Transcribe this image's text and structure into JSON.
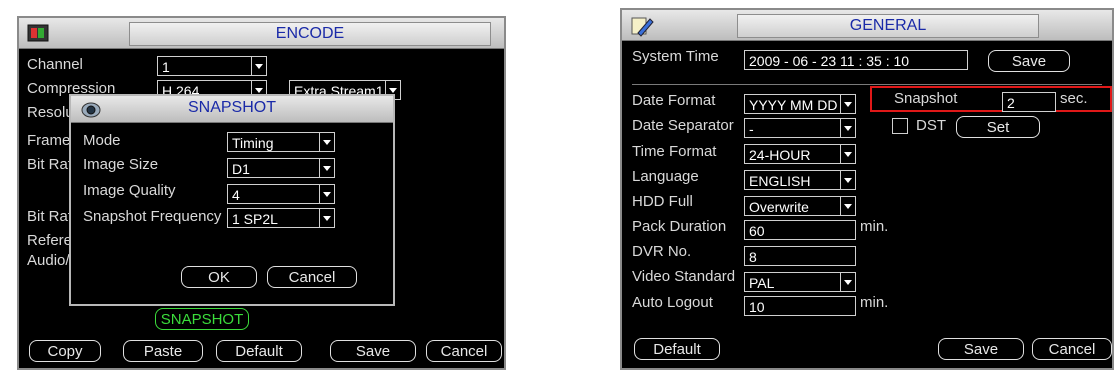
{
  "encode": {
    "title": "ENCODE",
    "channel_label": "Channel",
    "channel_value": "1",
    "compression_label": "Compression",
    "compression_value": "H.264",
    "stream_value": "Extra Stream1",
    "resolution_label_partial": "Resolu",
    "frame_label_partial": "Frame",
    "bitrate_label_partial": "Bit Rat",
    "bitrate2_label_partial": "Bit Rat",
    "reference_label_partial": "Refere",
    "audio_label_partial": "Audio/",
    "snapshot_button": "SNAPSHOT",
    "buttons": {
      "copy": "Copy",
      "paste": "Paste",
      "default": "Default",
      "save": "Save",
      "cancel": "Cancel"
    },
    "snapshot_dialog": {
      "title": "SNAPSHOT",
      "mode_label": "Mode",
      "mode_value": "Timing",
      "size_label": "Image Size",
      "size_value": "D1",
      "quality_label": "Image Quality",
      "quality_value": "4",
      "freq_label": "Snapshot Frequency",
      "freq_value": "1 SP2L",
      "ok": "OK",
      "cancel": "Cancel"
    }
  },
  "general": {
    "title": "GENERAL",
    "system_time_label": "System Time",
    "system_time_value": "2009 - 06 - 23  11 : 35 : 10",
    "save_time": "Save",
    "date_format_label": "Date Format",
    "date_format_value": "YYYY MM DD",
    "date_sep_label": "Date Separator",
    "date_sep_value": "-",
    "time_format_label": "Time Format",
    "time_format_value": "24-HOUR",
    "language_label": "Language",
    "language_value": "ENGLISH",
    "hdd_label": "HDD Full",
    "hdd_value": "Overwrite",
    "pack_label": "Pack Duration",
    "pack_value": "60",
    "pack_unit": "min.",
    "dvr_label": "DVR No.",
    "dvr_value": "8",
    "video_label": "Video Standard",
    "video_value": "PAL",
    "logout_label": "Auto Logout",
    "logout_value": "10",
    "logout_unit": "min.",
    "snapshot_label": "Snapshot",
    "snapshot_value": "2",
    "snapshot_unit": "sec.",
    "dst_label": "DST",
    "set_button": "Set",
    "buttons": {
      "default": "Default",
      "save": "Save",
      "cancel": "Cancel"
    },
    "highlight_color": "#e01818"
  }
}
